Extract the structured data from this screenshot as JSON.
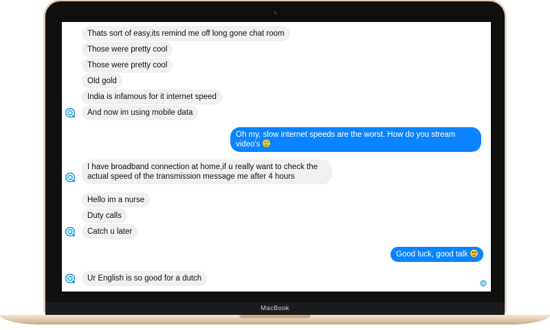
{
  "device": {
    "brand_label": "MacBook"
  },
  "chat": {
    "messages": [
      {
        "sender": "them",
        "text": "Thats sort of easy,its remind me off long gone chat room"
      },
      {
        "sender": "them",
        "text": "Those were pretty cool"
      },
      {
        "sender": "them",
        "text": "Those were pretty cool"
      },
      {
        "sender": "them",
        "text": "Old gold"
      },
      {
        "sender": "them",
        "text": "India is infamous for it internet speed"
      },
      {
        "sender": "them",
        "text": "And now im using mobile data"
      },
      {
        "sender": "me",
        "text": "Oh my, slow internet speeds are the worst. How do you stream video's",
        "emoji": "grinning-face-emoji"
      },
      {
        "sender": "them",
        "text": "I have broadband connection at home,if u really want to check the actual speed of the transmission message me after 4 hours"
      },
      {
        "sender": "them",
        "text": "Hello im a nurse"
      },
      {
        "sender": "them",
        "text": "Duty calls"
      },
      {
        "sender": "them",
        "text": "Catch u later"
      },
      {
        "sender": "me",
        "text": "Good luck, good talk",
        "emoji": "smiling-face-emoji"
      },
      {
        "sender": "them",
        "text": "Ur English is so good for a dutch"
      }
    ],
    "colors": {
      "outgoing_bubble": "#0a84ff",
      "incoming_bubble": "#f0f0f0",
      "avatar_accent": "#1a9bd7"
    },
    "icons": {
      "avatar": "contact-avatar-icon",
      "seen": "seen-avatar-icon"
    }
  }
}
